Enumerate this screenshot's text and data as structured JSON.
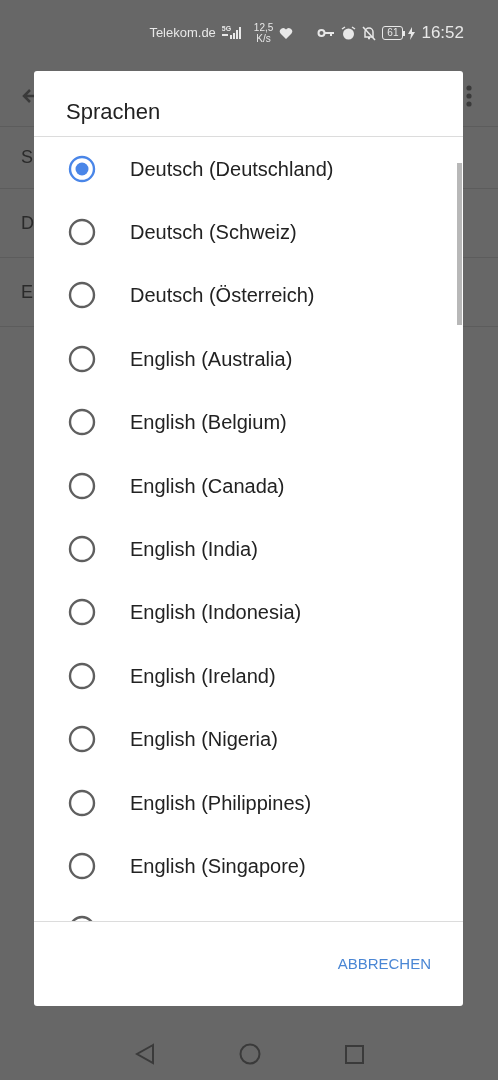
{
  "status_bar": {
    "carrier": "Telekom.de",
    "network_type": "5G",
    "speed_value": "12,5",
    "speed_unit": "K/s",
    "battery": "61",
    "time": "16:52"
  },
  "background_rows": [
    "S",
    "D",
    "E"
  ],
  "dialog": {
    "title": "Sprachen",
    "options": [
      {
        "label": "Deutsch (Deutschland)",
        "selected": true
      },
      {
        "label": "Deutsch (Schweiz)",
        "selected": false
      },
      {
        "label": "Deutsch (Österreich)",
        "selected": false
      },
      {
        "label": "English (Australia)",
        "selected": false
      },
      {
        "label": "English (Belgium)",
        "selected": false
      },
      {
        "label": "English (Canada)",
        "selected": false
      },
      {
        "label": "English (India)",
        "selected": false
      },
      {
        "label": "English (Indonesia)",
        "selected": false
      },
      {
        "label": "English (Ireland)",
        "selected": false
      },
      {
        "label": "English (Nigeria)",
        "selected": false
      },
      {
        "label": "English (Philippines)",
        "selected": false
      },
      {
        "label": "English (Singapore)",
        "selected": false
      },
      {
        "selected": false
      }
    ],
    "cancel_button": "ABBRECHEN"
  }
}
